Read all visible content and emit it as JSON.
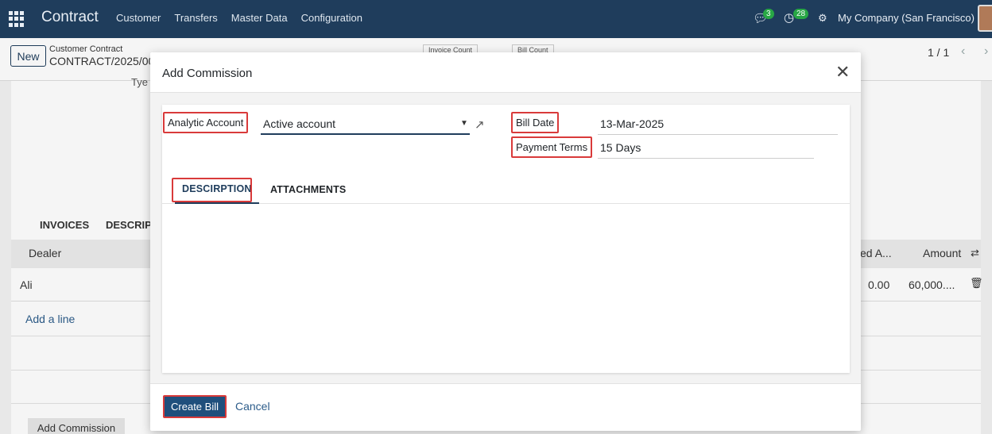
{
  "navbar": {
    "brand": "Contract",
    "menu": [
      "Customer",
      "Transfers",
      "Master Data",
      "Configuration"
    ],
    "chat_count": "3",
    "activity_count": "28",
    "company": "My Company (San Francisco)"
  },
  "control": {
    "new_label": "New",
    "breadcrumb_parent": "Customer Contract",
    "breadcrumb_current": "CONTRACT/2025/00",
    "invoice_count_label": "Invoice Count",
    "bill_count_label": "Bill Count",
    "pager": "1 / 1"
  },
  "background": {
    "type_label": "Tye",
    "tab_invoices": "INVOICES",
    "tab_description": "DESCRIPT",
    "col_dealer": "Dealer",
    "col_invoiced": "ed A...",
    "col_amount": "Amount",
    "row_dealer": "Ali",
    "row_invoiced": "0.00",
    "row_amount": "60,000....",
    "add_line": "Add a line",
    "add_commission": "Add Commission"
  },
  "modal": {
    "title": "Add Commission",
    "analytic_account_label": "Analytic Account",
    "analytic_account_value": "Active account",
    "bill_date_label": "Bill Date",
    "bill_date_value": "13-Mar-2025",
    "payment_terms_label": "Payment Terms",
    "payment_terms_value": "15 Days",
    "tabs": [
      "DESCIRPTION",
      "ATTACHMENTS"
    ],
    "create_bill_label": "Create Bill",
    "cancel_label": "Cancel"
  },
  "colors": {
    "navbar": "#1f3d5c",
    "primary": "#1f4f7c",
    "highlight": "#d93a3a",
    "badge": "#28a745"
  }
}
